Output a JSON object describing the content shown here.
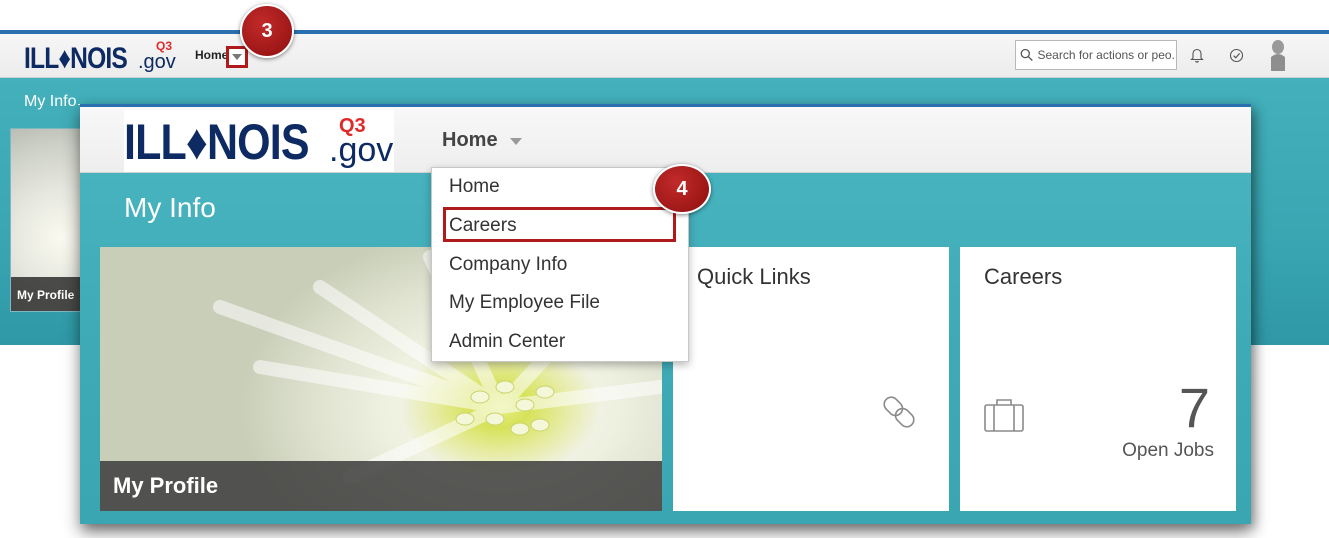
{
  "background_screenshot": {
    "logo": {
      "main": "ILL♦NOIS",
      "q3": "Q3",
      "gov": ".gov"
    },
    "nav": {
      "home_label": "Home"
    },
    "search": {
      "placeholder": "Search for actions or peo..."
    },
    "icons": [
      "search-icon",
      "bell-icon",
      "checkmark-circle-icon",
      "avatar"
    ],
    "section_title": "My Info",
    "profile_tile_label": "My Profile"
  },
  "callouts": {
    "step3": "3",
    "step4": "4"
  },
  "foreground_screenshot": {
    "logo": {
      "main": "ILL♦NOIS",
      "q3": "Q3",
      "gov": ".gov"
    },
    "nav": {
      "home_label": "Home"
    },
    "section_title": "My Info",
    "menu": {
      "items": [
        {
          "label": "Home"
        },
        {
          "label": "Careers",
          "highlighted": true
        },
        {
          "label": "Company Info"
        },
        {
          "label": "My Employee File"
        },
        {
          "label": "Admin Center"
        }
      ]
    },
    "tiles": {
      "profile": {
        "label": "My Profile"
      },
      "quick_links": {
        "title": "Quick Links",
        "icon": "link-icon"
      },
      "careers": {
        "title": "Careers",
        "icon": "briefcase-icon",
        "count": "7",
        "count_label": "Open Jobs"
      }
    }
  },
  "colors": {
    "teal": "#3eaab6",
    "brand_navy": "#0d2a63",
    "brand_red": "#e02a2a",
    "callout_red": "#b11a1a",
    "top_line_blue": "#2a6fb0"
  }
}
